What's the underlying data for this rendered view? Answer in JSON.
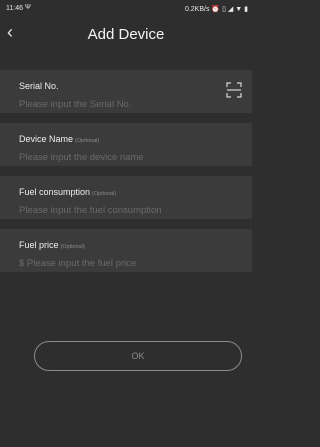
{
  "status_bar": {
    "time": "11:46",
    "usb_icon": "usb-icon",
    "net_speed": "0.2KB/s",
    "icons": [
      "alarm-icon",
      "vibrate-icon",
      "signal-icon",
      "wifi-icon",
      "battery-icon"
    ]
  },
  "header": {
    "back_icon": "chevron-left-icon",
    "title": "Add Device"
  },
  "form": {
    "serial": {
      "label": "Serial No.",
      "placeholder": "Please input the Serial No.",
      "scan_icon": "scan-icon"
    },
    "device_name": {
      "label": "Device Name",
      "optional": "(Optional)",
      "placeholder": "Please input the device name"
    },
    "fuel_consumption": {
      "label": "Fuel consumption",
      "optional": "(Optional)",
      "placeholder": "Please input the fuel consumption"
    },
    "fuel_price": {
      "label": "Fuel price",
      "optional": "(Optional)",
      "placeholder": "$ Please input the fuel price"
    }
  },
  "ok_label": "OK",
  "colors": {
    "background": "#2e2e2e",
    "field_background": "#3b3b3b",
    "placeholder": "#6a6a6a",
    "button_outline": "#8a8a8a"
  }
}
